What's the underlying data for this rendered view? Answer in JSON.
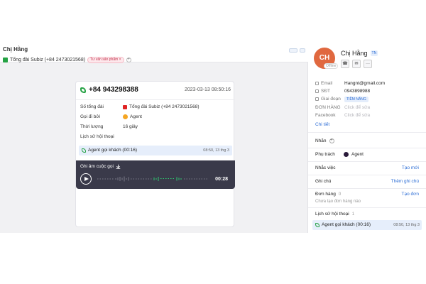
{
  "conversation": {
    "title": "Chị Hằng",
    "channel_label": "Tổng đài Subiz (+84 2473021568)",
    "tag_label": "Tư vấn sản phẩm ×",
    "tag_add": "+"
  },
  "call": {
    "phone": "+84 943298388",
    "datetime": "2023-03-13 08:50:16",
    "fields": [
      {
        "label": "Số tổng đài",
        "value": "Tổng đài Subiz (+84 2473021568)"
      },
      {
        "label": "Gọi đi bởi",
        "value": "Agent"
      },
      {
        "label": "Thời lượng",
        "value": "16 giây"
      },
      {
        "label": "Lịch sử hội thoại",
        "value": ""
      }
    ],
    "history_item": {
      "label": "Agent gọi khách (00:16)",
      "date": "08:50, 13 thg 3"
    },
    "recording": {
      "title": "Ghi âm cuộc gọi",
      "duration": "00:28"
    }
  },
  "contact": {
    "avatar_initials": "CH",
    "avatar_status": "Offline",
    "name": "Chị Hằng",
    "badge": "TN",
    "actions": {
      "call": "☎",
      "email": "✉",
      "more": "···"
    },
    "fields": {
      "email_label": "Email",
      "email_value": "Hangnt@gmail.com",
      "phone_label": "SĐT",
      "phone_value": "0943898988",
      "stage_label": "Giai đoạn",
      "stage_value": "TIỀM NĂNG",
      "order_label": "ĐƠN HÀNG",
      "order_placeholder": "Click để sửa",
      "facebook_label": "Facebook",
      "facebook_placeholder": "Click để sửa",
      "detail_link": "Chi tiết"
    },
    "sections": {
      "label_title": "Nhãn",
      "assignee_title": "Phụ trách",
      "assignee_value": "Agent",
      "reminder_title": "Nhắc việc",
      "reminder_action": "Tạo mới",
      "note_title": "Ghi chú",
      "note_action": "Thêm ghi chú",
      "orders_title": "Đơn hàng",
      "orders_count": "0",
      "orders_action": "Tạo đơn",
      "orders_empty": "Chưa tạo đơn hàng nào",
      "history_title": "Lịch sử hội thoại",
      "history_count": "1",
      "history_item": "Agent gọi khách (00:16)",
      "history_date": "08:50, 13 thg 3"
    }
  },
  "colors": {
    "accent": "#2f6fd6",
    "avatar": "#e0683f",
    "call_green": "#25a244",
    "player_bg": "#3a3a4a"
  }
}
